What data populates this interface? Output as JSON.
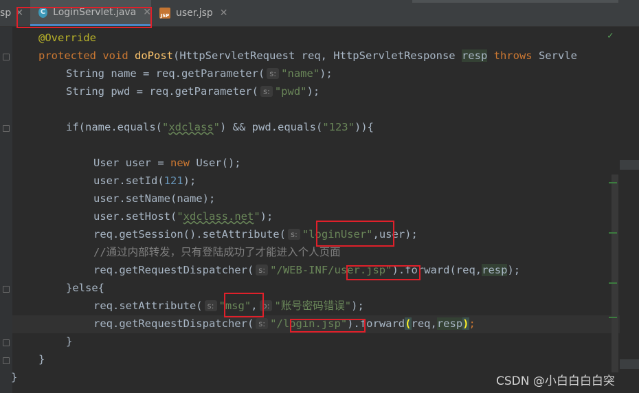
{
  "tabs": [
    {
      "label": "sp",
      "icon": "close-icon"
    },
    {
      "label": "LoginServlet.java",
      "icon": "java-class-icon",
      "active": true
    },
    {
      "label": "user.jsp",
      "icon": "jsp-file-icon"
    }
  ],
  "code": {
    "l1_ann": "@Override",
    "l2_protected": "protected",
    "l2_void": "void",
    "l2_method": "doPost",
    "l2_params": "(HttpServletRequest req, HttpServletResponse ",
    "l2_resp": "resp",
    "l2_throws": "throws",
    "l2_tail": " Servle",
    "l3_a": "String name = req.getParameter(",
    "l3_hint": "s:",
    "l3_str": "\"name\"",
    "l3_b": ");",
    "l4_a": "String pwd = req.getParameter(",
    "l4_hint": "s:",
    "l4_str": "\"pwd\"",
    "l4_b": ");",
    "l6_a": "if(name.equals(",
    "l6_str1": "\"",
    "l6_str2": "xdclass",
    "l6_str3": "\"",
    "l6_b": ") && pwd.equals(",
    "l6_str4": "\"123\"",
    "l6_c": ")){",
    "l8_a": "User user = ",
    "l8_new": "new",
    "l8_b": " User();",
    "l9_a": "user.setId(",
    "l9_num": "121",
    "l9_b": ");",
    "l10": "user.setName(name);",
    "l11_a": "user.setHost(",
    "l11_q1": "\"",
    "l11_str": "xdclass.net",
    "l11_q2": "\"",
    "l11_b": ");",
    "l12_a": "req.getSession().setAttribute(",
    "l12_hint": "s:",
    "l12_str": "\"loginUser\"",
    "l12_b": ",user);",
    "l13_cmt": "//通过内部转发，只有登陆成功了才能进入个人页面",
    "l14_a": "req.getRequestDispatcher(",
    "l14_hint": "s:",
    "l14_str": "\"/WEB-INF/user.jsp\"",
    "l14_b": ").forward(req,",
    "l14_resp": "resp",
    "l14_c": ");",
    "l15_a": "}else{",
    "l16_a": "req.setAttribute(",
    "l16_hint1": "s:",
    "l16_str1": "\"msg\"",
    "l16_comma": ",",
    "l16_hint2": "o:",
    "l16_str2": "\"账号密码错误\"",
    "l16_b": ");",
    "l17_a": "req.getRequestDispatcher(",
    "l17_hint": "s:",
    "l17_str": "\"/login.jsp\"",
    "l17_b": ").forward",
    "l17_paren": "(",
    "l17_args": "req,",
    "l17_resp": "resp",
    "l17_paren2": ")",
    "l17_semi": ";",
    "l18": "}",
    "l19": "}",
    "l20": "}"
  },
  "watermark": "CSDN @小白白白白突",
  "colors": {
    "keyword": "#cc7832",
    "string": "#6a8759",
    "annotation": "#bbb529",
    "method": "#ffc66d",
    "number": "#6897bb",
    "highlight_box": "#e0202a"
  }
}
